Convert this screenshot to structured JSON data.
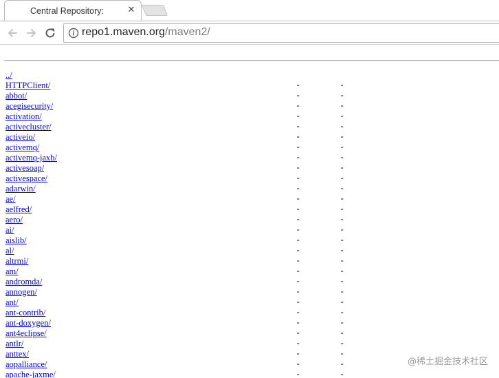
{
  "browser": {
    "tab": {
      "title": "Central Repository:",
      "close_glyph": "✕"
    },
    "toolbar": {
      "back_icon": "arrow-left-icon",
      "forward_icon": "arrow-right-icon",
      "reload_icon": "reload-icon",
      "info_icon": "info-circle-icon"
    },
    "address_bar": {
      "host": "repo1.maven.org",
      "path": "/maven2/"
    }
  },
  "listing": {
    "parent_link": "../",
    "entries": [
      {
        "name": "HTTPClient/",
        "date": "-",
        "size": "-"
      },
      {
        "name": "abbot/",
        "date": "-",
        "size": "-"
      },
      {
        "name": "acegisecurity/",
        "date": "-",
        "size": "-"
      },
      {
        "name": "activation/",
        "date": "-",
        "size": "-"
      },
      {
        "name": "activecluster/",
        "date": "-",
        "size": "-"
      },
      {
        "name": "activeio/",
        "date": "-",
        "size": "-"
      },
      {
        "name": "activemq/",
        "date": "-",
        "size": "-"
      },
      {
        "name": "activemq-jaxb/",
        "date": "-",
        "size": "-"
      },
      {
        "name": "activesoap/",
        "date": "-",
        "size": "-"
      },
      {
        "name": "activespace/",
        "date": "-",
        "size": "-"
      },
      {
        "name": "adarwin/",
        "date": "-",
        "size": "-"
      },
      {
        "name": "ae/",
        "date": "-",
        "size": "-"
      },
      {
        "name": "aelfred/",
        "date": "-",
        "size": "-"
      },
      {
        "name": "aero/",
        "date": "-",
        "size": "-"
      },
      {
        "name": "ai/",
        "date": "-",
        "size": "-"
      },
      {
        "name": "aislib/",
        "date": "-",
        "size": "-"
      },
      {
        "name": "al/",
        "date": "-",
        "size": "-"
      },
      {
        "name": "altrmi/",
        "date": "-",
        "size": "-"
      },
      {
        "name": "am/",
        "date": "-",
        "size": "-"
      },
      {
        "name": "andromda/",
        "date": "-",
        "size": "-"
      },
      {
        "name": "annogen/",
        "date": "-",
        "size": "-"
      },
      {
        "name": "ant/",
        "date": "-",
        "size": "-"
      },
      {
        "name": "ant-contrib/",
        "date": "-",
        "size": "-"
      },
      {
        "name": "ant-doxygen/",
        "date": "-",
        "size": "-"
      },
      {
        "name": "ant4eclipse/",
        "date": "-",
        "size": "-"
      },
      {
        "name": "antlr/",
        "date": "-",
        "size": "-"
      },
      {
        "name": "anttex/",
        "date": "-",
        "size": "-"
      },
      {
        "name": "aopalliance/",
        "date": "-",
        "size": "-"
      },
      {
        "name": "apache-jaxme/",
        "date": "-",
        "size": "-"
      }
    ]
  },
  "watermark": "@稀土掘金技术社区"
}
